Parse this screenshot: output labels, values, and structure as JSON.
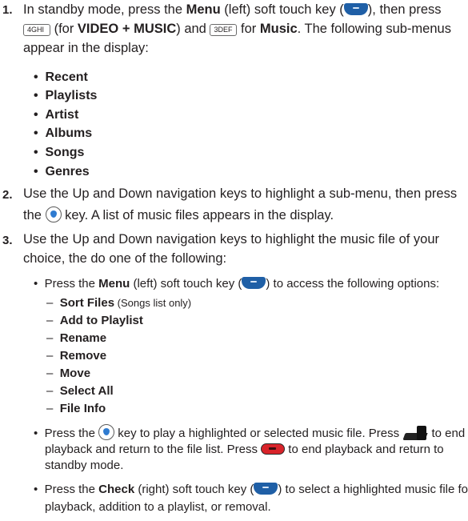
{
  "steps": [
    {
      "number": "1.",
      "l1_a": "In standby mode, press the ",
      "l1_b": "Menu",
      "l1_c": " (left) soft touch key (",
      "l1_d": "), then press",
      "key4_label": "4GHI",
      "l2_a": " (for ",
      "l2_b": "VIDEO + MUSIC",
      "l2_c": ") and ",
      "key3_label": "3DEF",
      "l2_d": " for ",
      "l2_e": "Music",
      "l2_f": ". The following sub-menus",
      "l3": "appear in the display:",
      "submenus": [
        "Recent",
        "Playlists",
        "Artist",
        "Albums",
        "Songs",
        "Genres"
      ]
    },
    {
      "number": "2.",
      "l1": "Use the Up and Down navigation keys to highlight a sub-menu, then press",
      "l2_a": "the ",
      "l2_b": " key. A list of music files appears in the display."
    },
    {
      "number": "3.",
      "l1": "Use the Up and Down navigation keys to highlight the music file of your",
      "l2": "choice, the do one of the following:",
      "b1_a": "Press the ",
      "b1_b": "Menu",
      "b1_c": " (left) soft touch key (",
      "b1_d": ") to access the following options:",
      "options": [
        {
          "label": "Sort Files",
          "note": " (Songs list only)"
        },
        {
          "label": "Add to Playlist",
          "note": ""
        },
        {
          "label": "Rename",
          "note": ""
        },
        {
          "label": "Remove",
          "note": ""
        },
        {
          "label": "Move",
          "note": ""
        },
        {
          "label": "Select All",
          "note": ""
        },
        {
          "label": "File Info",
          "note": ""
        }
      ],
      "b2_l1_a": "Press the ",
      "b2_l1_b": " key to play a highlighted or selected music file. Press ",
      "b2_l1_c": " to end",
      "b2_l2_a": "playback and return to the file list. Press ",
      "b2_l2_b": " to end playback and return to",
      "b2_l3": "standby mode.",
      "b3_l1_a": "Press the ",
      "b3_l1_b": "Check",
      "b3_l1_c": " (right) soft touch key (",
      "b3_l1_d": ") to select a highlighted music file for",
      "b3_l2": "playback, addition to a playlist, or removal."
    }
  ],
  "bullet_char": "•",
  "dash_char": "–",
  "icons": {
    "menu_softkey": "menu-softkey-icon",
    "ok_key": "ok-key-icon",
    "end_key": "end-key-icon",
    "power_key": "power-end-key-icon"
  },
  "colors": {
    "text": "#231f20",
    "softkey": "#1f5fa6",
    "ok_drop": "#2f7bd0",
    "end_red": "#d8232a"
  }
}
